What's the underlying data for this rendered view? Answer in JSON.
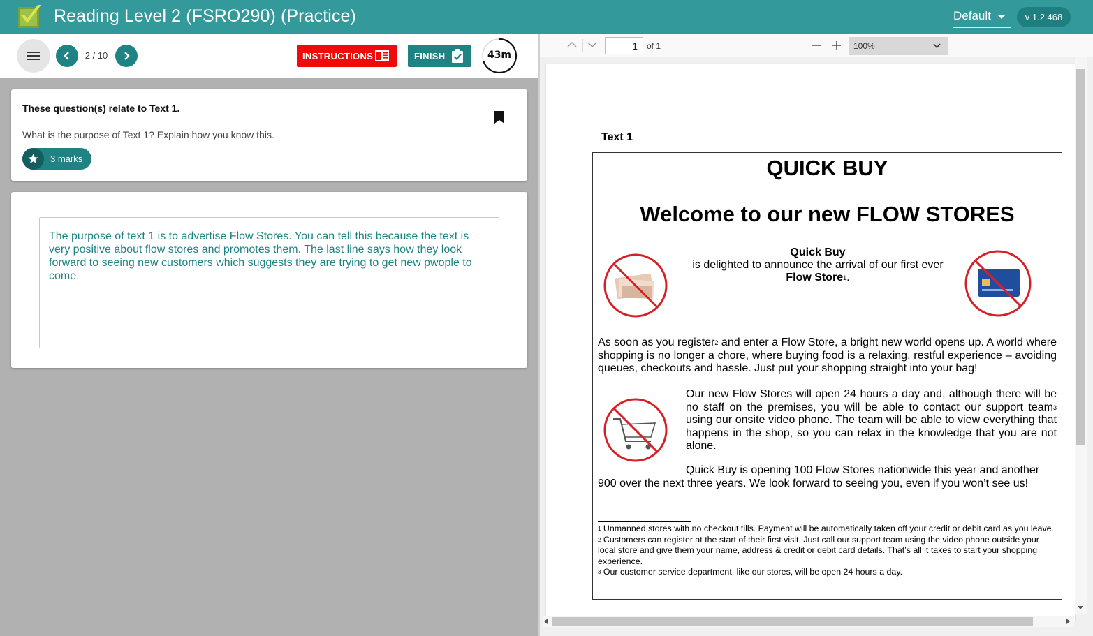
{
  "header": {
    "title": "Reading Level 2 (FSRO290) (Practice)",
    "theme_label": "Default",
    "version": "v 1.2.468",
    "accent_color": "#34999a"
  },
  "toolbar": {
    "page_indicator": "2 / 10",
    "instructions_label": "INSTRUCTIONS",
    "finish_label": "FINISH",
    "timer": "43m",
    "instructions_color": "#f00a0a",
    "primary_color": "#1f8384"
  },
  "question": {
    "heading": "These question(s) relate to Text 1.",
    "text": "What is the purpose of Text 1? Explain how you know this.",
    "marks": "3 marks"
  },
  "answer": {
    "text": "The purpose of text 1 is to advertise Flow Stores. You can tell this because the text is very positive about flow stores and promotes them. The last line says how they look forward to seeing new customers which suggests they are trying to get new pwople to come."
  },
  "pdf_viewer": {
    "current_page": "1",
    "page_of": "of 1",
    "zoom": "100%"
  },
  "document": {
    "label": "Text 1",
    "title": "QUICK BUY",
    "headline": "Welcome to our new FLOW STORES",
    "intro_brand": "Quick Buy",
    "intro_text": "is delighted to announce the arrival of our first ever",
    "intro_store": "Flow Store",
    "p1a": "As soon as you register",
    "p1b": " and enter a Flow Store, a bright new world opens up.  A world where shopping is no longer a chore, where buying food is a relaxing, restful experience – avoiding queues, checkouts and hassle. Just put your shopping straight into your bag!",
    "p2a": "Our new Flow Stores will open 24 hours a day and, although there will be no staff on the premises, you will be able to contact our support team",
    "p2b": " using our onsite video phone. The team will be able to view everything that happens in the shop, so you can relax in the knowledge that you are not alone.",
    "p3": "Quick Buy is opening 100 Flow Stores nationwide this year and another 900 over the next three years. We look forward to seeing you, even if you won’t see us!",
    "footnotes": [
      {
        "mark": "1",
        "text": " Unmanned stores with no checkout tills. Payment will be automatically taken off your credit or debit card as you leave."
      },
      {
        "mark": "2",
        "text": " Customers can register at the start of their first visit. Just call our support team using the video phone outside your local store and give them your name, address & credit or debit card details. That’s all it takes to start your shopping experience."
      },
      {
        "mark": "3",
        "text": " Our customer service department, like our stores, will be open 24 hours a day."
      }
    ],
    "sup1": "1",
    "sup2": "2",
    "sup3": "3"
  },
  "icons": {
    "logo": "checkmark-logo-icon",
    "menu": "hamburger-menu-icon",
    "prev": "chevron-left-icon",
    "next": "chevron-right-icon",
    "instructions": "document-icon",
    "finish": "clipboard-check-icon",
    "bookmark": "bookmark-icon",
    "marks": "star-icon"
  }
}
